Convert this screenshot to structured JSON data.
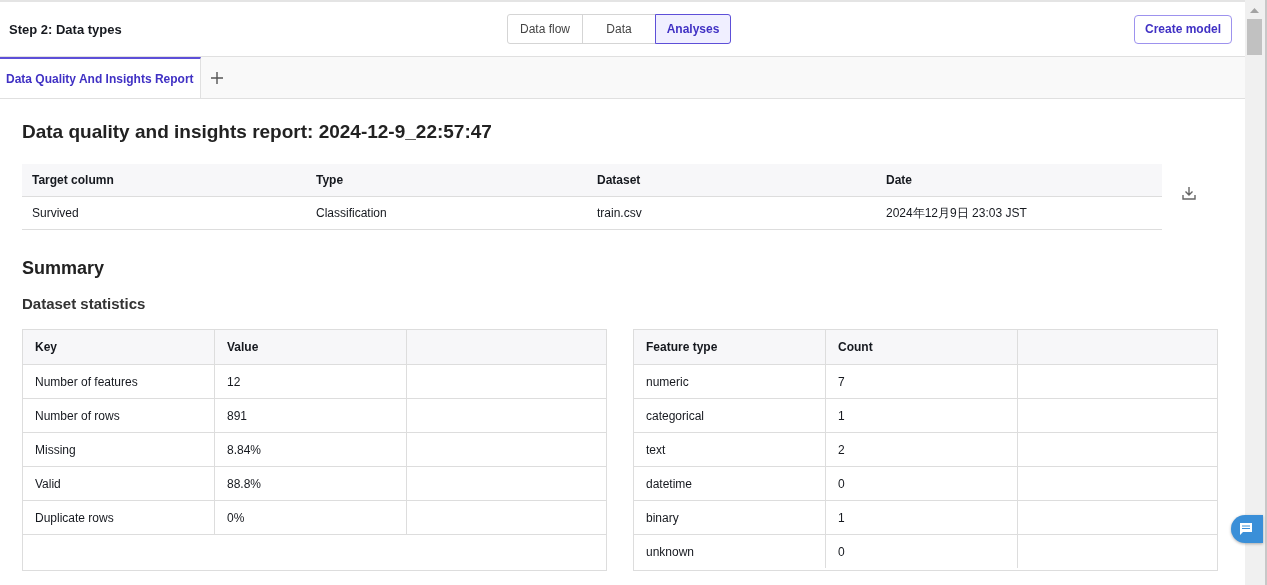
{
  "header": {
    "title": "Step 2: Data types",
    "view_tabs": [
      {
        "label": "Data flow",
        "selected": false
      },
      {
        "label": "Data",
        "selected": false
      },
      {
        "label": "Analyses",
        "selected": true
      }
    ],
    "create_button": "Create model"
  },
  "report_tabs": [
    {
      "label": "Data Quality And Insights Report",
      "selected": true
    }
  ],
  "report": {
    "title": "Data quality and insights report: 2024-12-9_22:57:47",
    "meta_table": {
      "columns": [
        "Target column",
        "Type",
        "Dataset",
        "Date"
      ],
      "rows": [
        [
          "Survived",
          "Classification",
          "train.csv",
          "2024年12月9日 23:03 JST"
        ]
      ]
    },
    "summary_heading": "Summary",
    "stats_heading": "Dataset statistics",
    "dataset_table": {
      "columns": [
        "Key",
        "Value"
      ],
      "rows": [
        [
          "Number of features",
          "12"
        ],
        [
          "Number of rows",
          "891"
        ],
        [
          "Missing",
          "8.84%"
        ],
        [
          "Valid",
          "88.8%"
        ],
        [
          "Duplicate rows",
          "0%"
        ]
      ]
    },
    "feature_table": {
      "columns": [
        "Feature type",
        "Count"
      ],
      "rows": [
        [
          "numeric",
          "7"
        ],
        [
          "categorical",
          "1"
        ],
        [
          "text",
          "2"
        ],
        [
          "datetime",
          "0"
        ],
        [
          "binary",
          "1"
        ],
        [
          "unknown",
          "0"
        ]
      ]
    }
  }
}
